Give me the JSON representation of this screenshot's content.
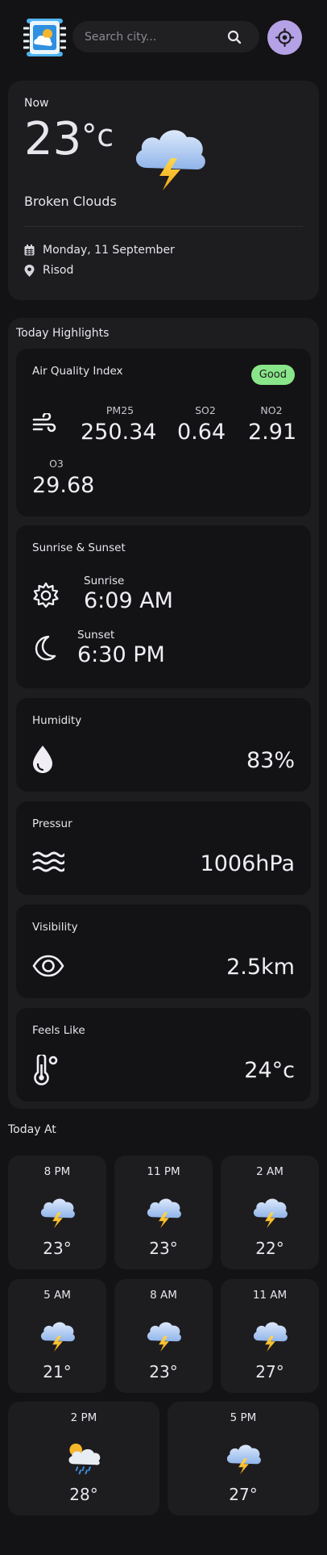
{
  "header": {
    "search_placeholder": "Search city..."
  },
  "now": {
    "label": "Now",
    "temp": "23",
    "unit": "°c",
    "description": "Broken Clouds",
    "date": "Monday, 11 September",
    "location": "Risod"
  },
  "highlights": {
    "title": "Today Highlights",
    "air_quality": {
      "title": "Air Quality Index",
      "badge": "Good",
      "items": [
        {
          "label": "PM25",
          "value": "250.34"
        },
        {
          "label": "SO2",
          "value": "0.64"
        },
        {
          "label": "NO2",
          "value": "2.91"
        },
        {
          "label": "O3",
          "value": "29.68"
        }
      ]
    },
    "sun": {
      "title": "Sunrise & Sunset",
      "sunrise_label": "Sunrise",
      "sunrise": "6:09 AM",
      "sunset_label": "Sunset",
      "sunset": "6:30 PM"
    },
    "humidity": {
      "title": "Humidity",
      "value": "83%"
    },
    "pressure": {
      "title": "Pressur",
      "value": "1006hPa"
    },
    "visibility": {
      "title": "Visibility",
      "value": "2.5km"
    },
    "feels_like": {
      "title": "Feels Like",
      "value": "24°c"
    }
  },
  "today_at": {
    "title": "Today At",
    "hours": [
      {
        "time": "8 PM",
        "temp": "23°",
        "icon": "thunder-cloud-icon"
      },
      {
        "time": "11 PM",
        "temp": "23°",
        "icon": "thunder-cloud-icon"
      },
      {
        "time": "2 AM",
        "temp": "22°",
        "icon": "thunder-cloud-icon"
      },
      {
        "time": "5 AM",
        "temp": "21°",
        "icon": "thunder-cloud-icon"
      },
      {
        "time": "8 AM",
        "temp": "23°",
        "icon": "thunder-cloud-icon"
      },
      {
        "time": "11 AM",
        "temp": "27°",
        "icon": "thunder-cloud-icon"
      },
      {
        "time": "2 PM",
        "temp": "28°",
        "icon": "sun-rain-cloud-icon"
      },
      {
        "time": "5 PM",
        "temp": "27°",
        "icon": "thunder-cloud-icon"
      }
    ]
  },
  "colors": {
    "background": "#131214",
    "card": "#1d1c1f",
    "accent": "#b5a1e5",
    "good_badge": "#89e589"
  }
}
